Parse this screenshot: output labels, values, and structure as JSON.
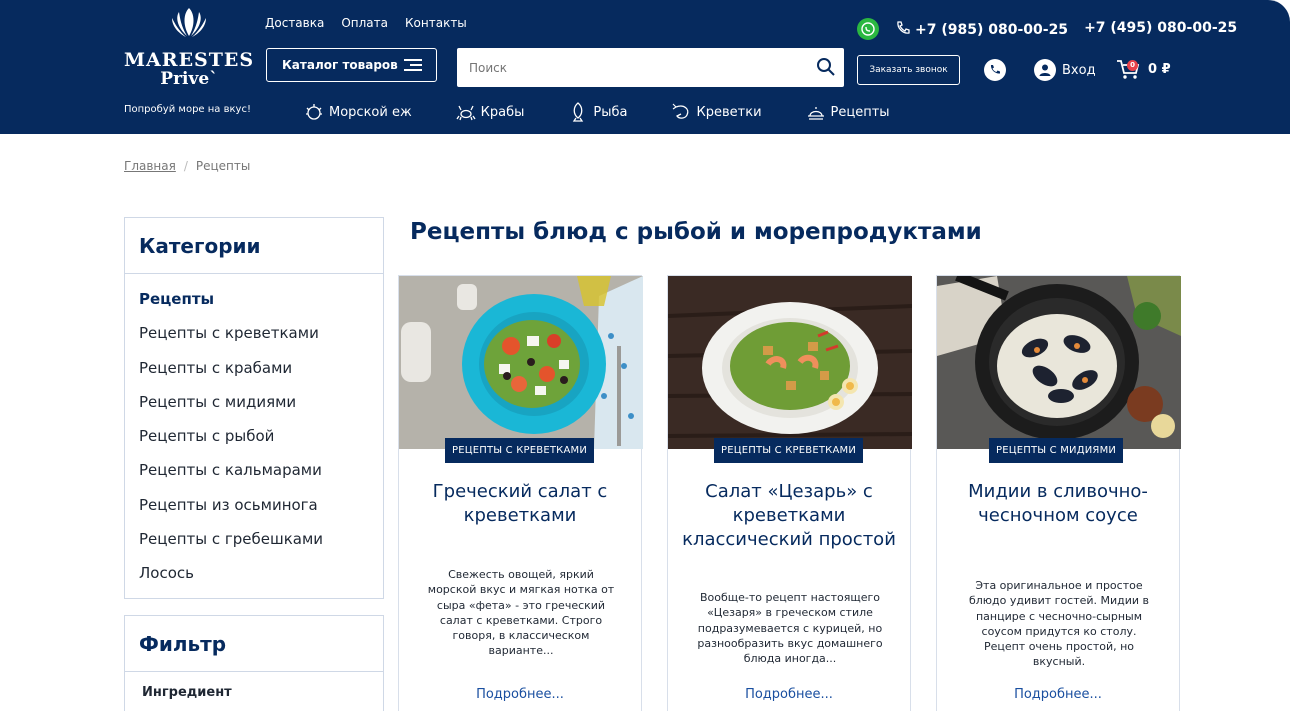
{
  "header": {
    "logo_name": "MARESTES",
    "logo_sub": "Prive`",
    "slogan": "Попробуй море на вкус!",
    "top_links": [
      "Доставка",
      "Оплата",
      "Контакты"
    ],
    "catalog_label": "Каталог товаров",
    "search_placeholder": "Поиск",
    "callback_label": "Заказать звонок",
    "phone_1": "+7 (985) 080-00-25",
    "phone_2": "+7 (495) 080-00-25",
    "login_label": "Вход",
    "cart_count": "0",
    "cart_total": "0 ₽",
    "nav": [
      "Морской еж",
      "Крабы",
      "Рыба",
      "Креветки",
      "Рецепты"
    ]
  },
  "breadcrumb": {
    "home": "Главная",
    "current": "Рецепты"
  },
  "sidebar": {
    "categories_title": "Категории",
    "categories": [
      "Рецепты",
      "Рецепты с креветками",
      "Рецепты с крабами",
      "Рецепты с мидиями",
      "Рецепты с рыбой",
      "Рецепты с кальмарами",
      "Рецепты из осьминога",
      "Рецепты с гребешками",
      "Лосось"
    ],
    "filter_title": "Фильтр",
    "filter_ingredient": "Ингредиент"
  },
  "main": {
    "title": "Рецепты блюд с рыбой и морепродуктами",
    "more_label": "Подробнее...",
    "cards": [
      {
        "tag": "РЕЦЕПТЫ С КРЕВЕТКАМИ",
        "title": "Греческий салат с креветками",
        "desc": "Свежесть овощей, яркий морской вкус и мягкая нотка от сыра «фета» - это греческий салат с креветками. Строго говоря, в классическом варианте..."
      },
      {
        "tag": "РЕЦЕПТЫ С КРЕВЕТКАМИ",
        "title": "Салат «Цезарь» с креветками классический простой",
        "desc": "Вообще-то рецепт настоящего «Цезаря» в греческом стиле подразумевается с курицей, но разнообразить вкус домашнего блюда иногда..."
      },
      {
        "tag": "РЕЦЕПТЫ С МИДИЯМИ",
        "title": "Мидии в сливочно-чесночном соусе",
        "desc": "Эта оригинальное и простое блюдо удивит гостей. Мидии в панцире с чесночно-сырным соусом придутся ко столу. Рецепт очень простой, но вкусный."
      }
    ]
  },
  "colors": {
    "brand": "#062a5e",
    "whatsapp": "#2bb741",
    "badge": "#e8424c",
    "link": "#1a4fa0"
  }
}
